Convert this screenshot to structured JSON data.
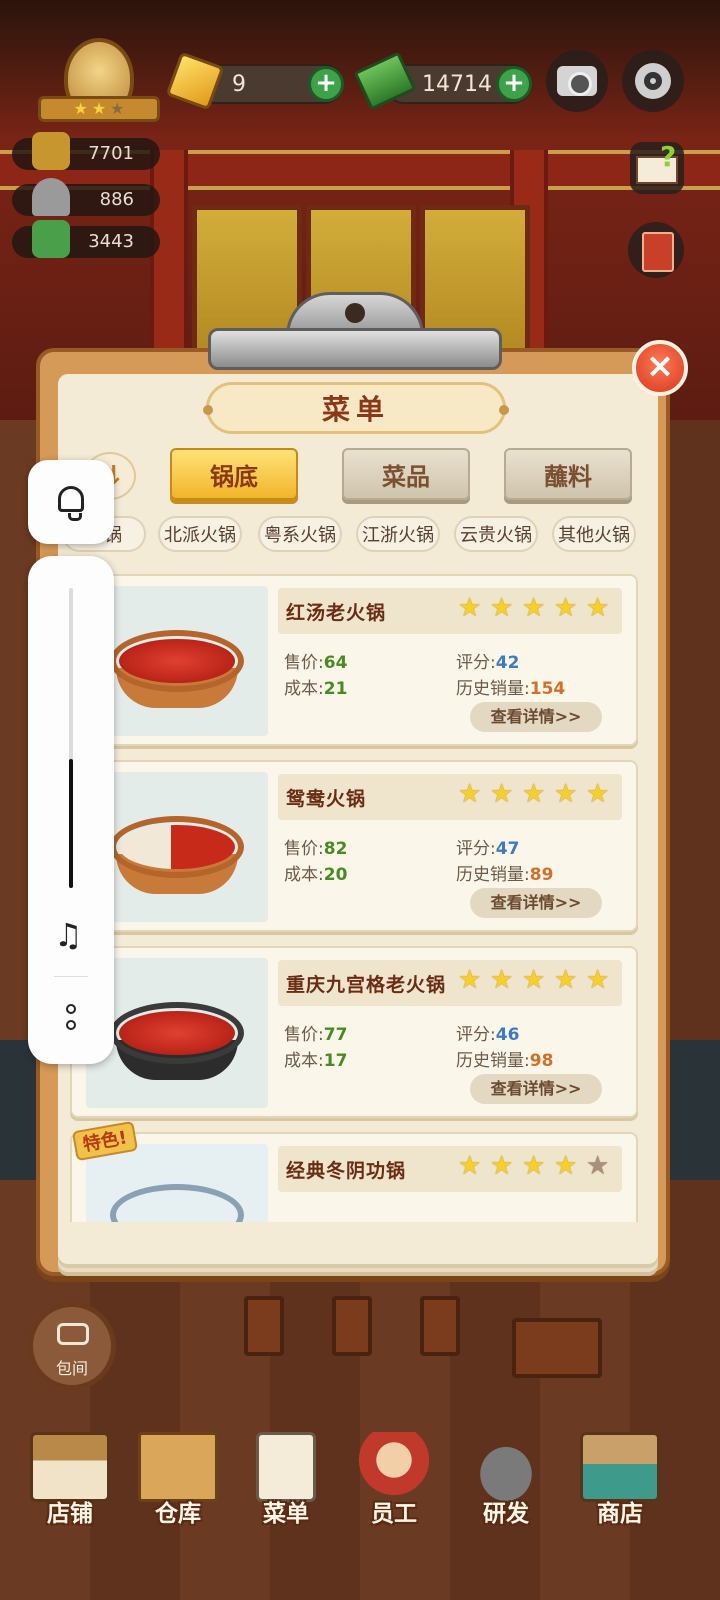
{
  "hud": {
    "gems": "9",
    "cash": "14714",
    "stats": [
      "7701",
      "886",
      "3443"
    ]
  },
  "menu": {
    "title": "菜单",
    "close_label": "×",
    "sort_label": "⇅",
    "tabs": [
      {
        "label": "锅底",
        "active": true
      },
      {
        "label": "菜品",
        "active": false
      },
      {
        "label": "蘸料",
        "active": false
      }
    ],
    "filters": [
      "火锅",
      "北派火锅",
      "粤系火锅",
      "江浙火锅",
      "云贵火锅",
      "其他火锅"
    ],
    "labels": {
      "price": "售价:",
      "cost": "成本:",
      "rating": "评分:",
      "sales": "历史销量:",
      "detail": "查看详情>>",
      "special": "特色!"
    },
    "dishes": [
      {
        "name": "红汤老火锅",
        "price": "64",
        "cost": "21",
        "rating": "42",
        "sales": "154",
        "stars": 5
      },
      {
        "name": "鸳鸯火锅",
        "price": "82",
        "cost": "20",
        "rating": "47",
        "sales": "89",
        "stars": 5
      },
      {
        "name": "重庆九宫格老火锅",
        "price": "77",
        "cost": "17",
        "rating": "46",
        "sales": "98",
        "stars": 5
      },
      {
        "name": "经典冬阴功锅",
        "stars": 4,
        "special": true
      }
    ]
  },
  "overlay": {
    "volume_level": 0.43
  },
  "room_button": "包间",
  "nav": [
    {
      "label": "店铺",
      "icon": "storefront-icon"
    },
    {
      "label": "仓库",
      "icon": "warehouse-boxes-icon"
    },
    {
      "label": "菜单",
      "icon": "menu-clipboard-icon"
    },
    {
      "label": "员工",
      "icon": "staff-chef-icon"
    },
    {
      "label": "研发",
      "icon": "research-wok-icon"
    },
    {
      "label": "商店",
      "icon": "shop-stall-icon"
    }
  ]
}
